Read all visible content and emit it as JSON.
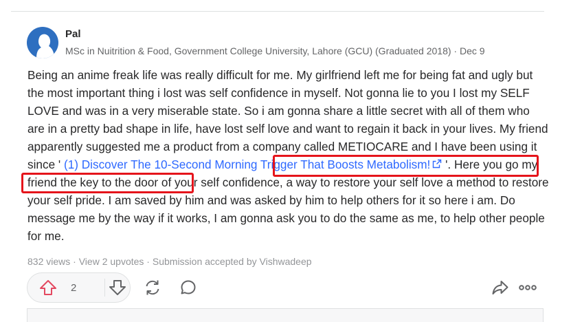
{
  "answer": {
    "author": "Pal",
    "credential": "MSc in Nuitrition & Food, Government College University, Lahore (GCU) (Graduated 2018)",
    "separator": " · ",
    "date": "Dec 9",
    "text_before": "Being an anime freak life was really difficult for me. My girlfriend left me for being fat and ugly but the most important thing i lost was self confidence in myself. Not gonna lie to you I lost my SELF LOVE and was in a very miserable state. So i am gonna share a little secret with all of them who are in a pretty bad shape in life, have lost self love and want to regain it back in your lives. My friend apparently suggested me a product from a company called METIOCARE and I have been using it since ' ",
    "link_text": "(1) Discover The 10-Second Morning Trigger That Boosts Metabolism!",
    "text_after": " '. Here you go my friend the key to the door of your self confidence, a way to restore your self love a method to restore your self pride. I am saved by him and was asked by him to help others for it so here i am. Do message me by the way if it works, I am gonna ask you to do the same as me, to help other people for me."
  },
  "meta": {
    "views": "832 views",
    "upvotes": "View 2 upvotes",
    "submission": "Submission accepted by Vishwadeep",
    "dot": " · "
  },
  "actions": {
    "upvote_count": "2"
  },
  "colors": {
    "link": "#2e69ff",
    "highlight_box": "#e5141b",
    "avatar": "#2e6fc0",
    "upvote_icon": "#e34860"
  },
  "icons": [
    "avatar-silhouette",
    "external-link-icon",
    "upvote-arrow-icon",
    "downvote-arrow-icon",
    "share-reshare-icon",
    "comment-icon",
    "share-forward-icon",
    "more-options-icon"
  ]
}
